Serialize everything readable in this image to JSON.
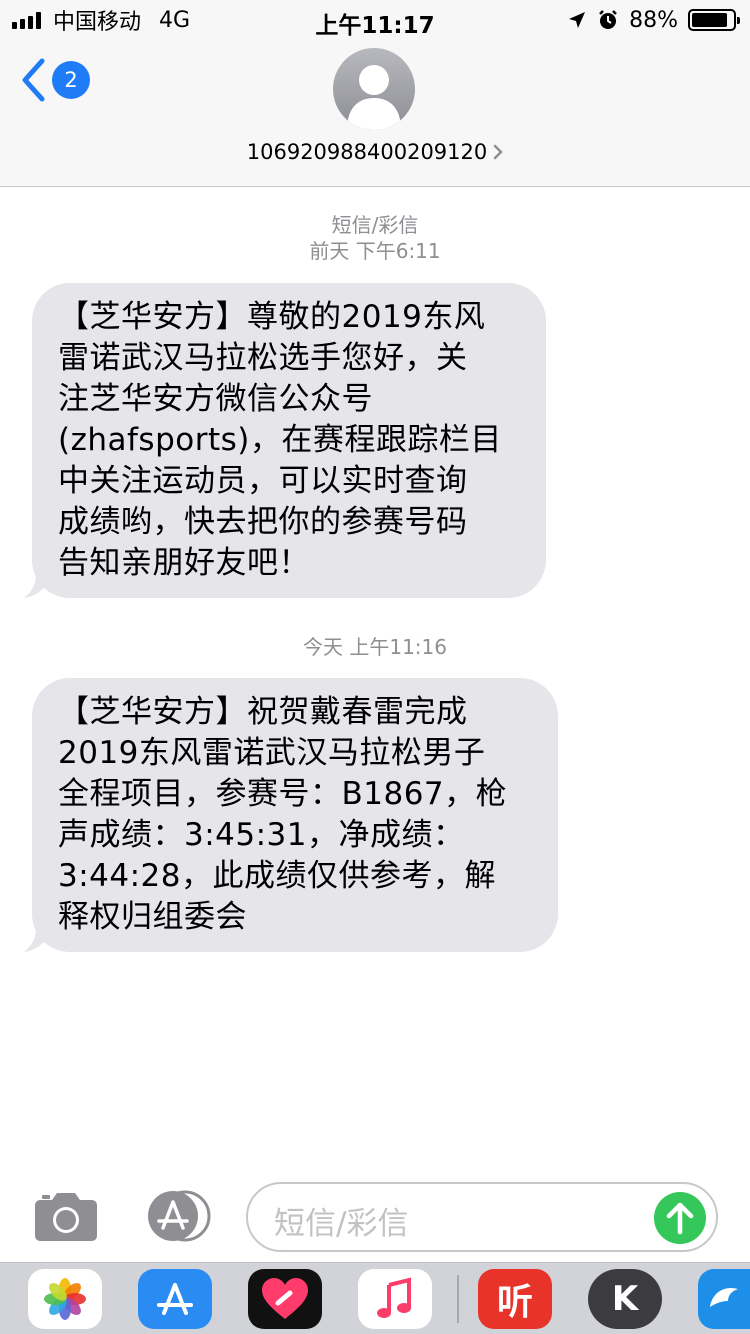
{
  "status_bar": {
    "carrier": "中国移动",
    "network": "4G",
    "time": "上午11:17",
    "battery_percent": "88%",
    "battery_level": 0.88
  },
  "nav": {
    "back_count": "2",
    "contact": "106920988400209120",
    "icons": [
      "chevron-left-icon",
      "contact-avatar-icon",
      "chevron-right-icon"
    ]
  },
  "conversation": {
    "service_label": "短信/彩信",
    "messages": [
      {
        "timestamp": "前天 下午6:11",
        "lines": [
          "【芝华安方】尊敬的2019东风",
          "雷诺武汉马拉松选手您好，关",
          "注芝华安方微信公众号",
          "(zhafsports)，在赛程跟踪栏目",
          "中关注运动员，可以实时查询",
          "成绩哟，快去把你的参赛号码",
          "告知亲朋好友吧！"
        ]
      },
      {
        "timestamp": "今天 上午11:16",
        "lines": [
          "【芝华安方】祝贺戴春雷完成",
          "2019东风雷诺武汉马拉松男子",
          "全程项目，参赛号：B1867，枪",
          "声成绩：3:45:31，净成绩：",
          "3:44:28，此成绩仅供参考，解",
          "释权归组委会"
        ]
      }
    ]
  },
  "input_bar": {
    "placeholder": "短信/彩信",
    "icons": [
      "camera-icon",
      "app-store-icon",
      "send-arrow-icon"
    ]
  },
  "app_drawer": {
    "apps": [
      "photos-app-icon",
      "app-store-app-icon",
      "heart-app-icon",
      "music-app-icon",
      "listen-app-icon",
      "k-app-icon",
      "dolphin-app-icon"
    ],
    "listen_glyph": "听",
    "k_glyph": "K"
  },
  "colors": {
    "bubble": "#e5e5ea",
    "accent_blue": "#1f7cf6",
    "send_green": "#35c759",
    "meta_gray": "#8e8e93"
  }
}
